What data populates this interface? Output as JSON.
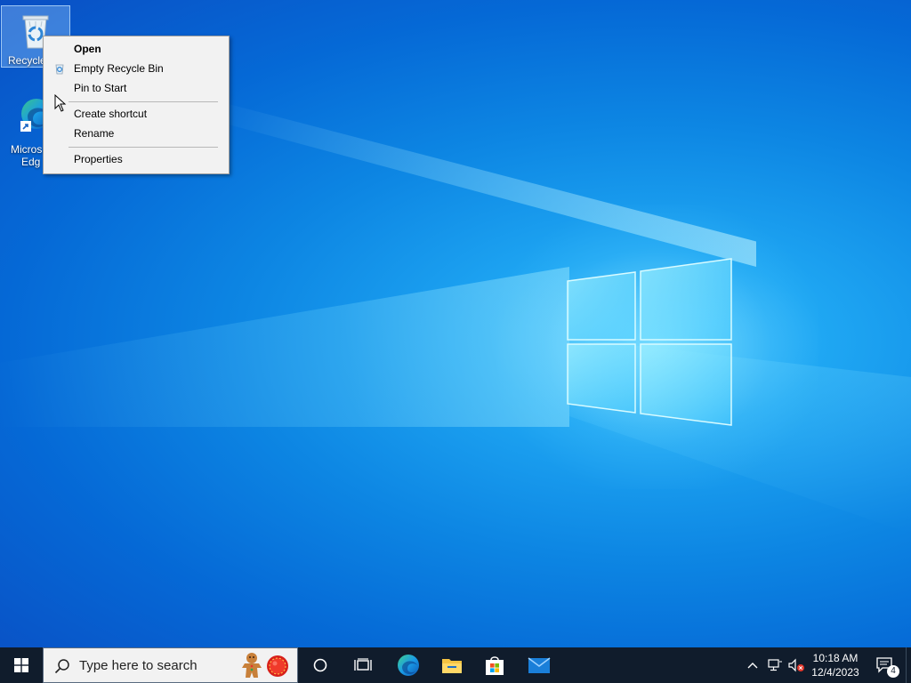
{
  "desktop": {
    "icons": [
      {
        "label": "Recycle",
        "icon": "recycle-bin-icon"
      },
      {
        "label_line1": "Micros",
        "label_line2": "Edg",
        "icon": "microsoft-edge-icon"
      }
    ]
  },
  "context_menu": {
    "items": [
      {
        "label": "Open",
        "bold": true
      },
      {
        "label": "Empty Recycle Bin",
        "icon": "recycle-bin-mini-icon"
      },
      {
        "label": "Pin to Start"
      },
      {
        "label": "Create shortcut"
      },
      {
        "label": "Rename"
      },
      {
        "label": "Properties"
      }
    ]
  },
  "taskbar": {
    "search_placeholder": "Type here to search",
    "apps": [
      "cortana-icon",
      "task-view-icon",
      "edge-icon",
      "file-explorer-icon",
      "microsoft-store-icon",
      "mail-icon"
    ],
    "clock": {
      "time": "10:18 AM",
      "date": "12/4/2023"
    },
    "notification_count": "4"
  },
  "colors": {
    "taskbar_bg": "#101c2c",
    "menu_bg": "#f2f2f2",
    "wallpaper_accent": "#0d86e3"
  }
}
